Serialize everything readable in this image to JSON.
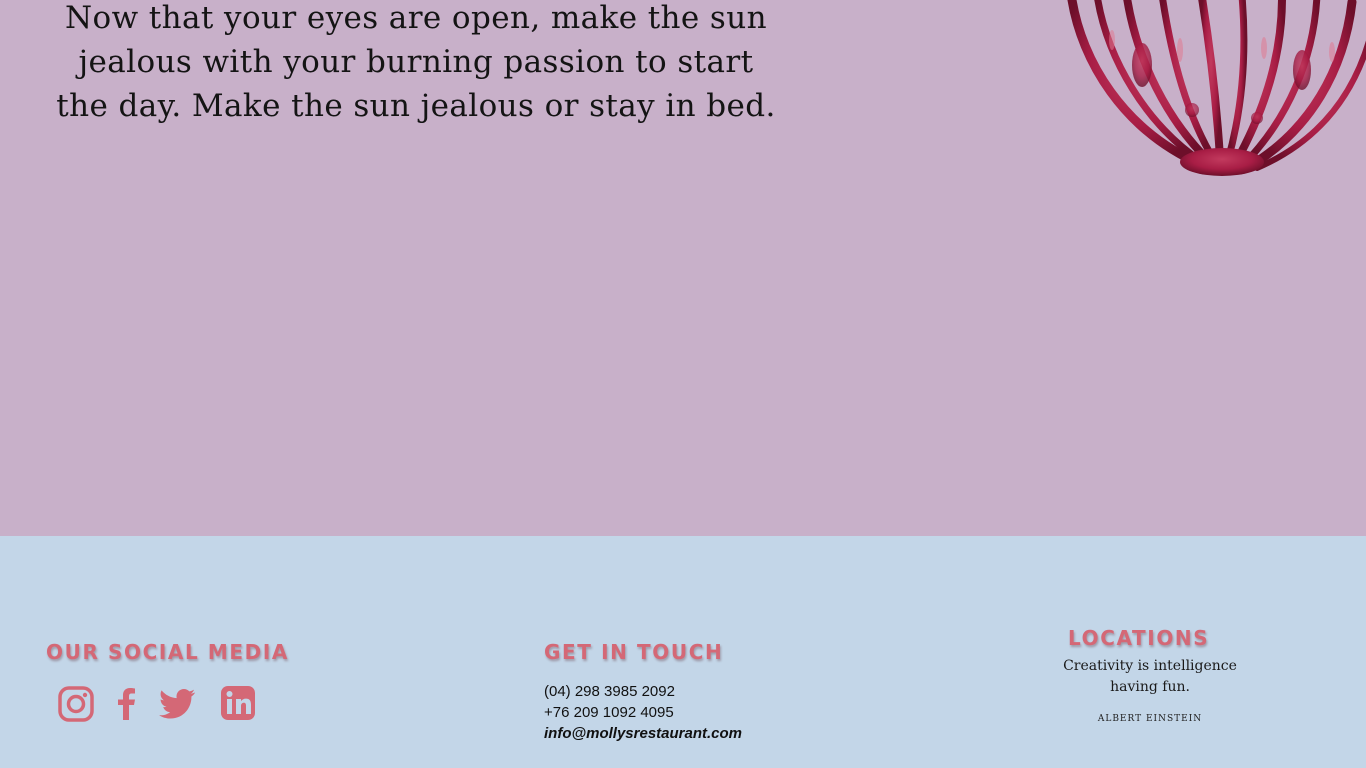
{
  "hero": {
    "quote_lines": [
      "Now that your eyes are open, make the sun",
      "jealous with your burning passion to start",
      "the day. Make the sun jealous or stay in bed."
    ],
    "image_icon": "red-paint-whisk-sculpture"
  },
  "footer": {
    "social": {
      "heading": "Our Social Media",
      "icons": [
        "instagram-icon",
        "facebook-icon",
        "twitter-icon",
        "linkedin-icon"
      ]
    },
    "contact": {
      "heading": "Get in Touch",
      "phone1": "(04) 298 3985 2092",
      "phone2": "+76 209 1092 4095",
      "email": "info@mollysrestaurant.com"
    },
    "locations": {
      "heading": "Locations",
      "quote_line1": "Creativity is intelligence",
      "quote_line2": "having fun.",
      "author": "ALBERT EINSTEIN"
    }
  },
  "colors": {
    "hero_bg": "#c8b0c9",
    "footer_bg": "#c3d6e8",
    "accent": "#d46876",
    "art_red": "#a81d45"
  }
}
